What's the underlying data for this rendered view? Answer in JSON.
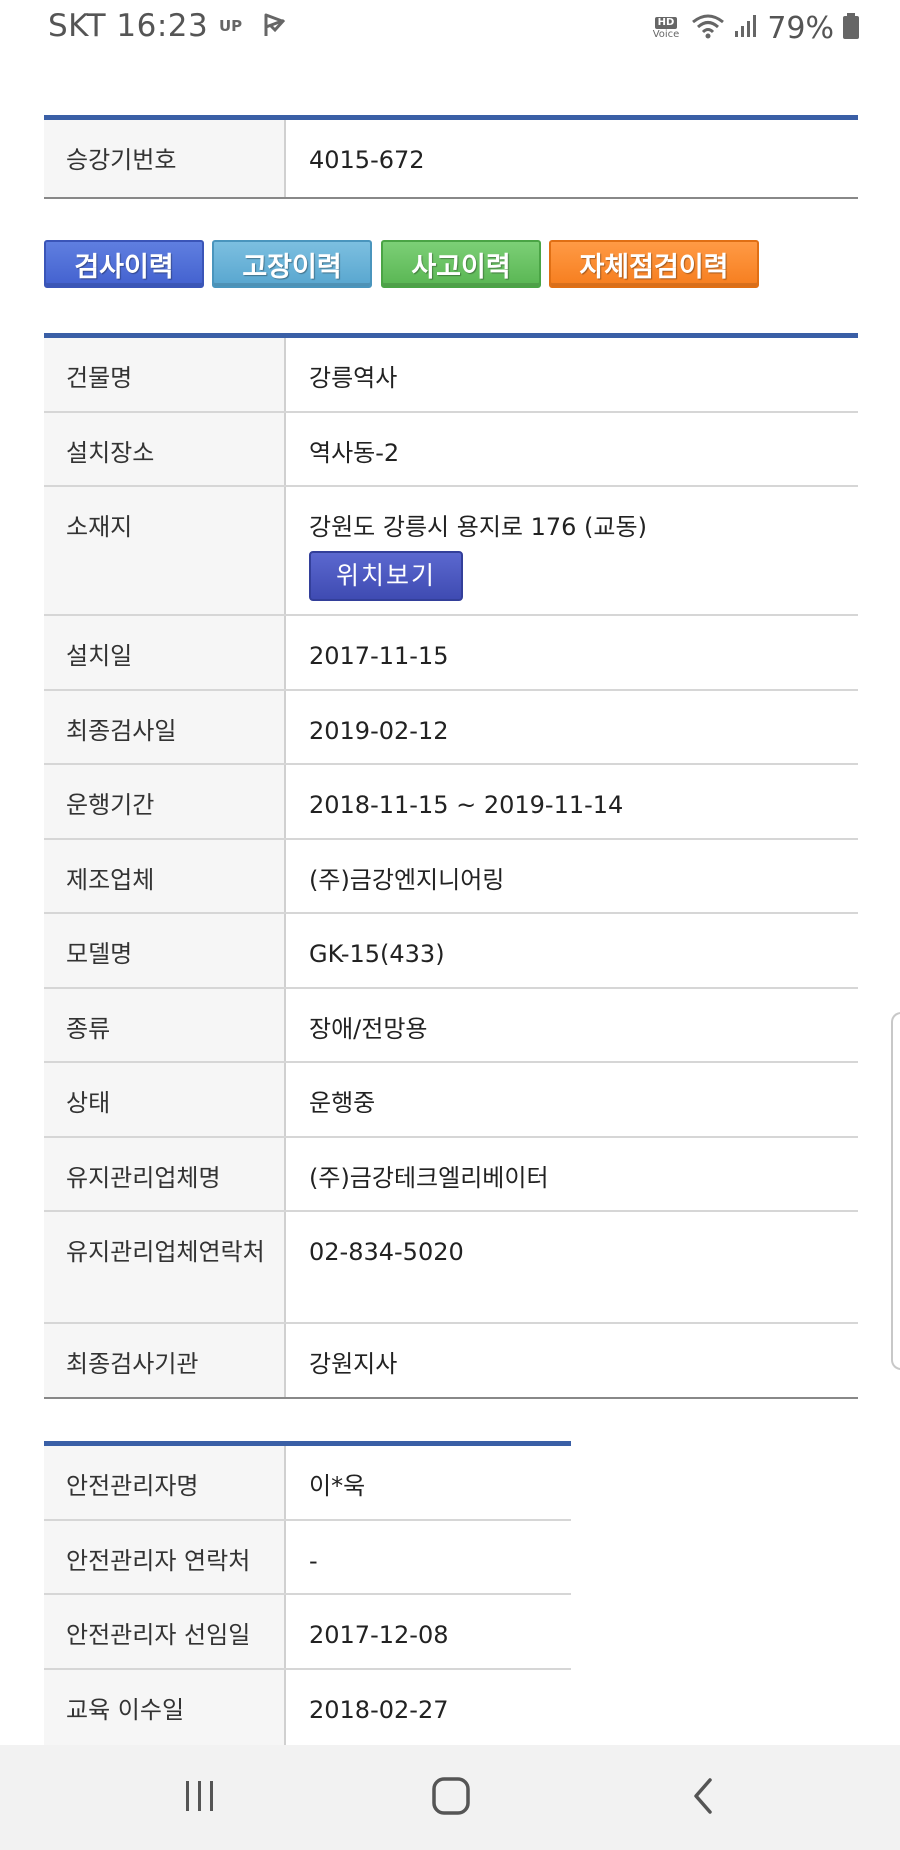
{
  "status_bar": {
    "carrier_time": "SKT 16:23",
    "up_label": "UP",
    "hd_label": "HD",
    "voice_label": "Voice",
    "battery": "79%"
  },
  "unit_table": {
    "label": "승강기번호",
    "value": "4015-672"
  },
  "history_buttons": {
    "inspection": "검사이력",
    "fault": "고장이력",
    "accident": "사고이력",
    "self_check": "자체점검이력"
  },
  "detail_table": {
    "building_label": "건물명",
    "building_value": "강릉역사",
    "location_label": "설치장소",
    "location_value": "역사동-2",
    "address_label": "소재지",
    "address_value": "강원도 강릉시 용지로 176 (교동)",
    "map_button": "위치보기",
    "install_date_label": "설치일",
    "install_date_value": "2017-11-15",
    "last_inspect_label": "최종검사일",
    "last_inspect_value": "2019-02-12",
    "operation_period_label": "운행기간",
    "operation_period_value": "2018-11-15 ~ 2019-11-14",
    "manufacturer_label": "제조업체",
    "manufacturer_value": "(주)금강엔지니어링",
    "model_label": "모델명",
    "model_value": "GK-15(433)",
    "type_label": "종류",
    "type_value": "장애/전망용",
    "state_label": "상태",
    "state_value": "운행중",
    "maint_company_label": "유지관리업체명",
    "maint_company_value": "(주)금강테크엘리베이터",
    "maint_contact_label": "유지관리업체연락처",
    "maint_contact_value": "02-834-5020",
    "inspect_agency_label": "최종검사기관",
    "inspect_agency_value": "강원지사"
  },
  "safety_table": {
    "manager_name_label": "안전관리자명",
    "manager_name_value": "이*욱",
    "manager_contact_label": "안전관리자 연락처",
    "manager_contact_value": "-",
    "appoint_date_label": "안전관리자 선임일",
    "appoint_date_value": "2017-12-08",
    "training_date_label": "교육 이수일",
    "training_date_value": "2018-02-27"
  },
  "icons": {
    "flag": "check-flag-icon",
    "wifi": "wifi-icon",
    "signal": "signal-icon",
    "battery": "battery-icon",
    "recents": "recents-icon",
    "home": "home-icon",
    "back": "back-icon"
  },
  "colors": {
    "table_accent": "#3a5fa6",
    "inspection_btn": "#4f6fd8",
    "fault_btn": "#6ab2d8",
    "accident_btn": "#66c060",
    "self_check_btn": "#f98a2e",
    "map_btn": "#4a56bd"
  }
}
